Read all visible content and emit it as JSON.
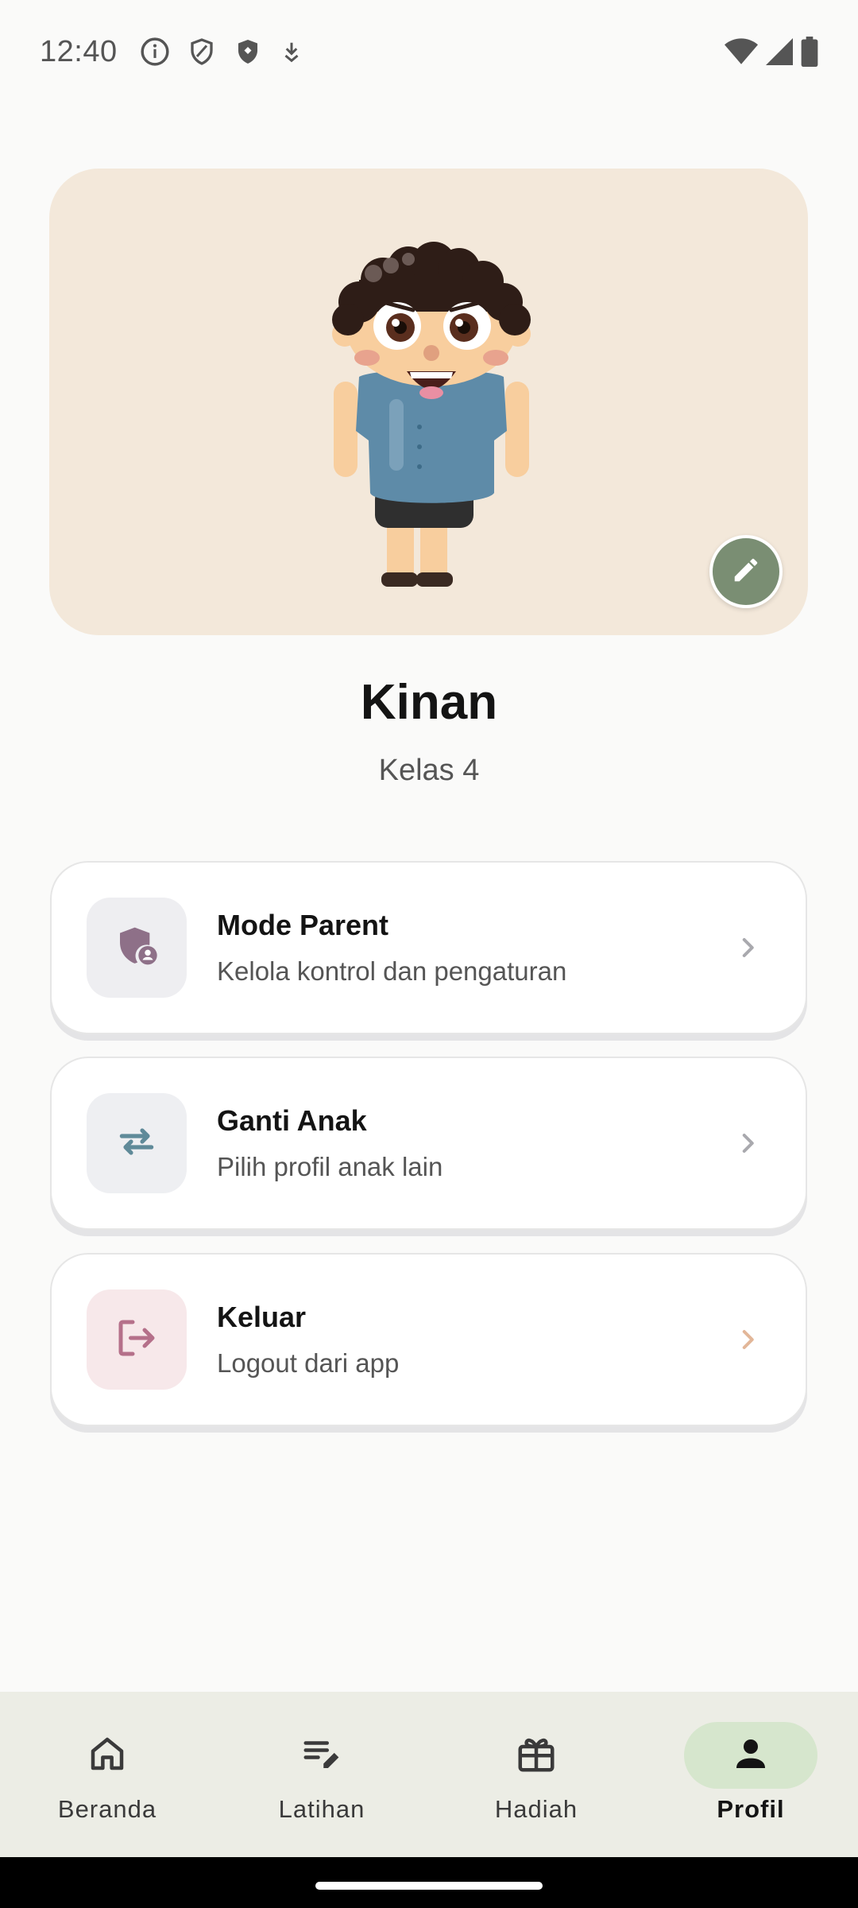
{
  "status_bar": {
    "time": "12:40",
    "left_icons": [
      "info-icon",
      "shield-outline-icon",
      "shield-filled-icon",
      "download-icon"
    ],
    "right_icons": [
      "wifi-icon",
      "signal-icon",
      "battery-icon"
    ]
  },
  "profile": {
    "avatar": "boy-character-illustration",
    "edit_icon": "pencil-icon",
    "name": "Kinan",
    "class": "Kelas 4"
  },
  "menu": [
    {
      "title": "Mode Parent",
      "subtitle": "Kelola kontrol dan pengaturan",
      "icon": "shield-person-icon",
      "icon_color": "#8E7088",
      "box_color": "#EEEEF1"
    },
    {
      "title": "Ganti Anak",
      "subtitle": "Pilih profil anak lain",
      "icon": "swap-arrows-icon",
      "icon_color": "#5F8A99",
      "box_color": "#EEEFF2"
    },
    {
      "title": "Keluar",
      "subtitle": "Logout dari app",
      "icon": "logout-icon",
      "icon_color": "#B5708A",
      "box_color": "#F7E8EA"
    }
  ],
  "bottom_nav": [
    {
      "label": "Beranda",
      "icon": "home-icon",
      "active": false
    },
    {
      "label": "Latihan",
      "icon": "edit-list-icon",
      "active": false
    },
    {
      "label": "Hadiah",
      "icon": "gift-icon",
      "active": false
    },
    {
      "label": "Profil",
      "icon": "person-icon",
      "active": true
    }
  ],
  "colors": {
    "background": "#FAFAF9",
    "avatar_card": "#F3E8DA",
    "edit_button": "#7A8E73",
    "nav_background": "#ECEDE5",
    "nav_active_pill": "#D6E6CD"
  }
}
